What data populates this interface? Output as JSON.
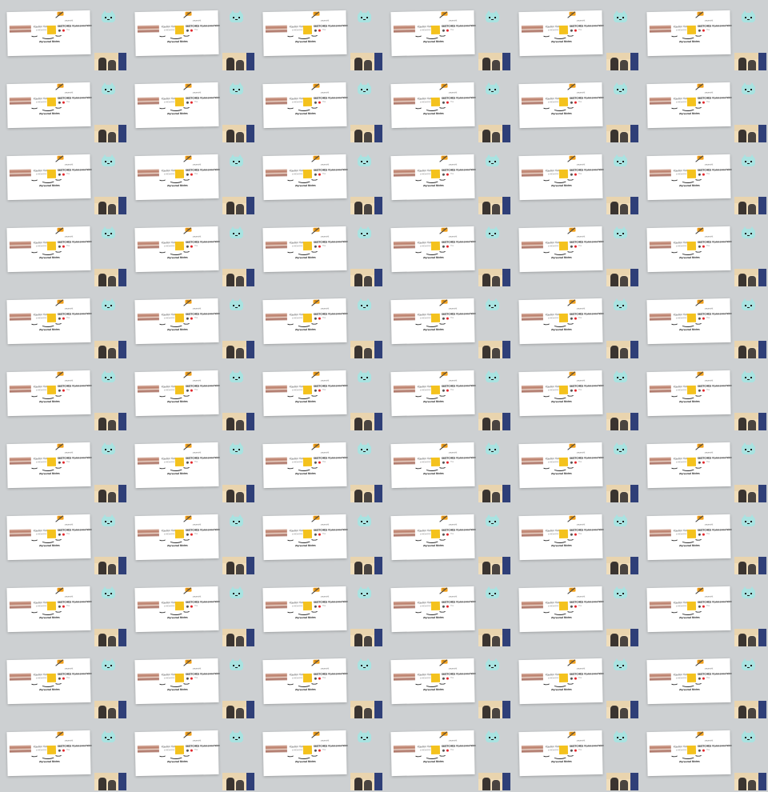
{
  "tile": {
    "card": {
      "handle": "Kayden ficks",
      "sub_a": "SOMEWHERE",
      "badge": "NEW!",
      "sub_b": "CREATURE",
      "headline": "SKETCHES Kaisesseutsko",
      "tiny": "Shop",
      "signature": "Personal Notes"
    },
    "cat_icon": "mint-cat-face-icon",
    "thumbnail": "photo-of-two-people"
  },
  "grid": {
    "columns": 6,
    "rows": 11
  },
  "colors": {
    "background": "#cdd0d2",
    "card": "#ffffff",
    "accent_yellow": "#f4c21d",
    "badge_orange": "#f4a11a",
    "cat_mint": "#a9e3e1",
    "red_dot": "#e2262b"
  }
}
